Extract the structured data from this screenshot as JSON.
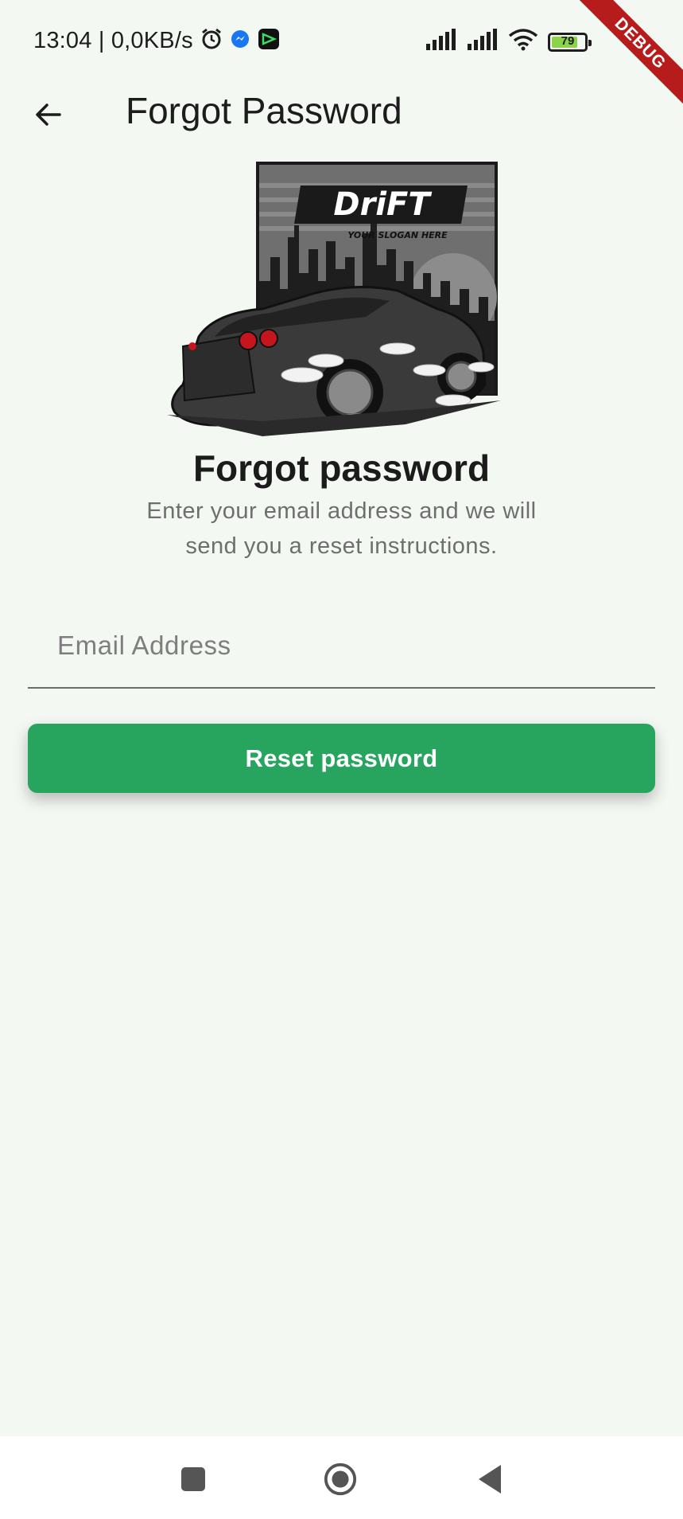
{
  "status_bar": {
    "time_text": "13:04 | 0,0KB/s",
    "battery_level": "79",
    "battery_percent": 79,
    "debug_label": "DEBUG"
  },
  "app_bar": {
    "title": "Forgot Password"
  },
  "logo": {
    "brand_text": "DriFT",
    "slogan_text": "YOUR SLOGAN HERE"
  },
  "content": {
    "heading": "Forgot password",
    "subtext": "Enter your email address and we will send you a reset instructions."
  },
  "form": {
    "email_placeholder": "Email Address",
    "email_value": "",
    "reset_label": "Reset password"
  },
  "colors": {
    "background": "#f4f8f3",
    "primary_button": "#27a55f",
    "debug_banner": "#b71c1c"
  },
  "icons": {
    "back": "arrow-left-icon",
    "alarm": "alarm-clock-icon",
    "messenger": "messenger-icon",
    "app": "app-notification-icon",
    "signal": "signal-icon",
    "wifi": "wifi-icon",
    "battery": "battery-icon",
    "nav_recents": "square-icon",
    "nav_home": "circle-icon",
    "nav_back": "triangle-back-icon"
  }
}
